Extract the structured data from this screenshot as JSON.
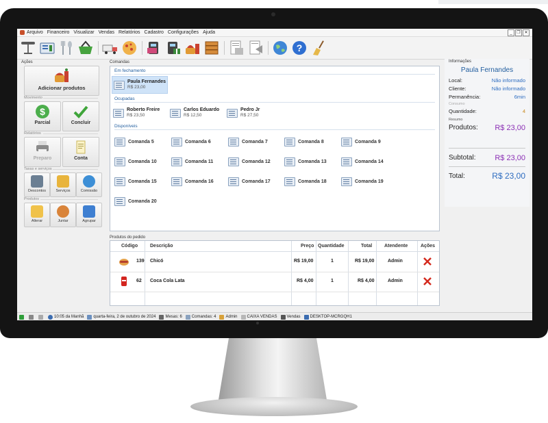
{
  "menu": [
    "Arquivo",
    "Financeiro",
    "Visualizar",
    "Vendas",
    "Relatórios",
    "Cadastro",
    "Configurações",
    "Ajuda"
  ],
  "window_buttons": [
    "_",
    "❐",
    "✕"
  ],
  "toolbar_icons": [
    "table-icon",
    "cash-register-icon",
    "cutlery-icon",
    "basket-icon",
    "delivery-truck-icon",
    "pizza-icon",
    "card-reader-icon",
    "card-payment-icon",
    "meal-icon",
    "wood-box-icon",
    "report-icon",
    "print-report-icon",
    "globe-icon",
    "help-icon",
    "broom-icon"
  ],
  "actions": {
    "title": "Ações",
    "add_products": "Adicionar produtos",
    "movimento_label": "Movimento",
    "parcial": "Parcial",
    "concluir": "Concluir",
    "relatorios_label": "Relatórios",
    "preparo": "Preparo",
    "conta": "Conta",
    "taxas_label": "Taxas e serviços",
    "descontos": "Descontos",
    "servicos": "Serviços",
    "comissao": "Comissão",
    "produtos_label": "Produtos",
    "alterar": "Alterar",
    "juntar": "Juntar",
    "agrupar": "Agrupar"
  },
  "comandas": {
    "title": "Comandas",
    "em_fechamento_label": "Em fechamento",
    "em_fechamento": [
      {
        "name": "Paula Fernandes",
        "value": "R$ 23,00"
      }
    ],
    "ocupadas_label": "Ocupadas",
    "ocupadas": [
      {
        "name": "Roberto Freire",
        "value": "R$ 23,50"
      },
      {
        "name": "Carlos Eduardo",
        "value": "R$ 12,50"
      },
      {
        "name": "Pedro Jr",
        "value": "R$ 27,50"
      }
    ],
    "disponiveis_label": "Disponíveis",
    "disponiveis": [
      "Comanda 5",
      "Comanda 6",
      "Comanda 7",
      "Comanda 8",
      "Comanda 9",
      "Comanda 10",
      "Comanda 11",
      "Comanda 12",
      "Comanda 13",
      "Comanda 14",
      "Comanda 15",
      "Comanda 16",
      "Comanda 17",
      "Comanda 18",
      "Comanda 19",
      "Comanda 20"
    ]
  },
  "produtos": {
    "title": "Produtos do pedido",
    "headers": {
      "codigo": "Código",
      "descricao": "Descrição",
      "preco": "Preço",
      "quantidade": "Quantidade",
      "total": "Total",
      "atendente": "Atendente",
      "acoes": "Ações"
    },
    "rows": [
      {
        "icon": "hotdog-icon",
        "codigo": "139",
        "descricao": "Chicó",
        "preco": "R$ 19,00",
        "quantidade": "1",
        "total": "R$ 19,00",
        "atendente": "Admin"
      },
      {
        "icon": "soda-can-icon",
        "codigo": "62",
        "descricao": "Coca Cola Lata",
        "preco": "R$ 4,00",
        "quantidade": "1",
        "total": "R$ 4,00",
        "atendente": "Admin"
      }
    ]
  },
  "info": {
    "title": "Informações",
    "name": "Paula Fernandes",
    "local_label": "Local:",
    "local_value": "Não informado",
    "cliente_label": "Cliente:",
    "cliente_value": "Não informado",
    "permanencia_label": "Permanência:",
    "permanencia_value": "6min",
    "consumo_label": "Consumo",
    "quantidade_label": "Quantidade:",
    "quantidade_value": "4",
    "resumo_label": "Resumo",
    "produtos_label": "Produtos:",
    "produtos_value": "R$ 23,00",
    "subtotal_label": "Subtotal:",
    "subtotal_value": "R$ 23,00",
    "total_label": "Total:",
    "total_value": "R$ 23,00"
  },
  "status": {
    "time": "10:05 da Manhã",
    "date": "quarta-feira, 2 de outubro de 2024",
    "mesas": "Mesas: 6",
    "comandas": "Comandas: 4",
    "user": "Admin",
    "caixa": "CAIXA VENDAS",
    "vendas": "Vendas",
    "host": "DESKTOP-MCRGQH1"
  },
  "colors": {
    "accent": "#1f5c9e",
    "produtos_value": "#8b2fb5",
    "subtotal_value": "#8b2fb5",
    "total_value": "#2d6cc0",
    "quantidade_value": "#c98a1e"
  }
}
